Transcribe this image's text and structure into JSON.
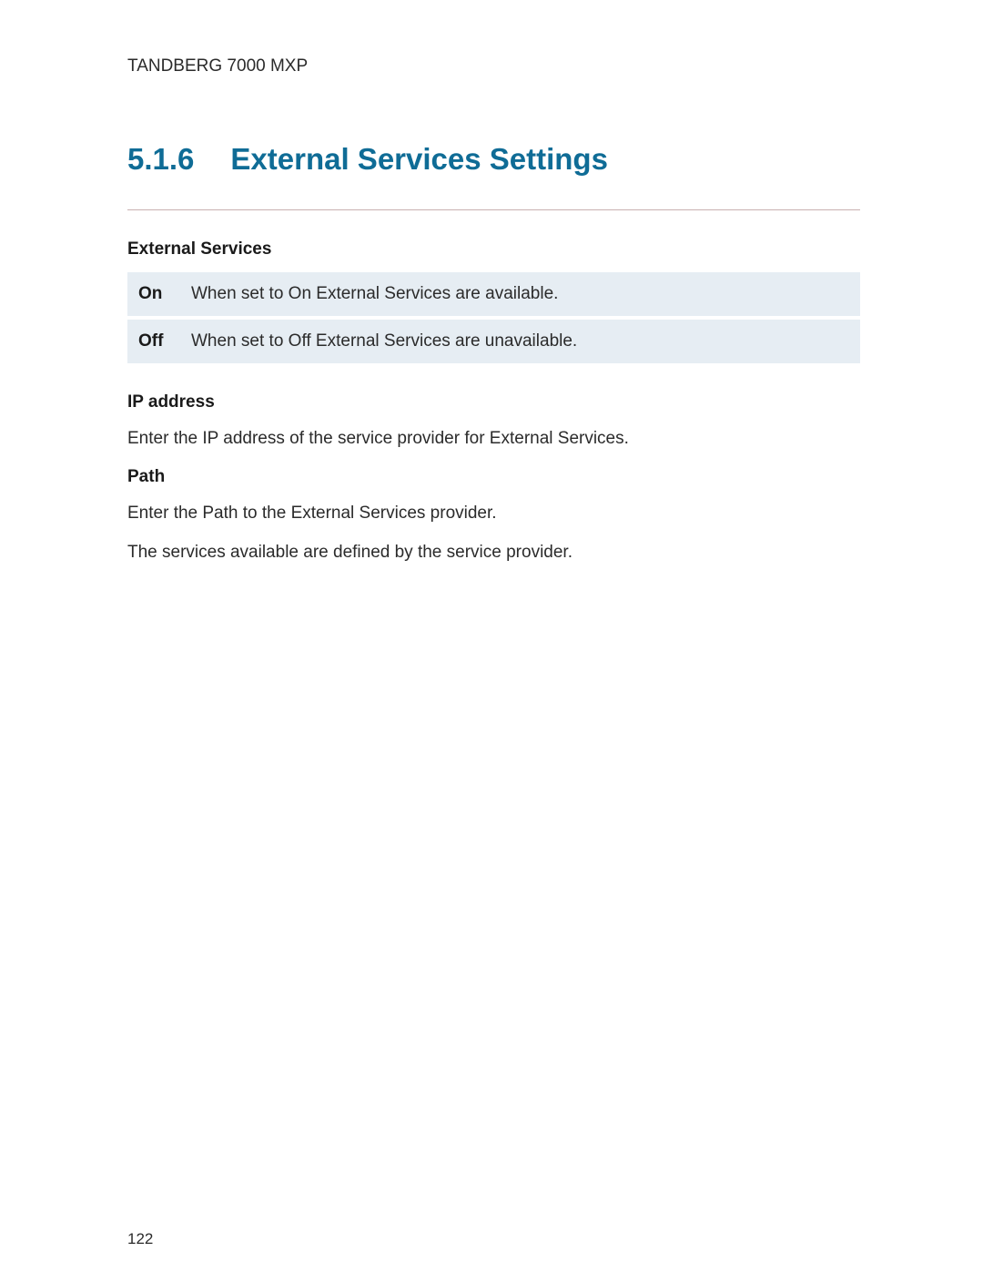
{
  "header": {
    "product_name": "TANDBERG 7000 MXP"
  },
  "section": {
    "number": "5.1.6",
    "title": "External Services Settings"
  },
  "external_services": {
    "heading": "External Services",
    "rows": [
      {
        "label": "On",
        "description": "When set to On External Services are available."
      },
      {
        "label": "Off",
        "description": "When set to Off External Services are unavailable."
      }
    ]
  },
  "ip_address": {
    "heading": "IP address",
    "text": "Enter the IP address of the service provider for External Services."
  },
  "path": {
    "heading": "Path",
    "text1": "Enter the Path to the External Services provider.",
    "text2": "The services available are defined by the service provider."
  },
  "footer": {
    "page_number": "122"
  }
}
